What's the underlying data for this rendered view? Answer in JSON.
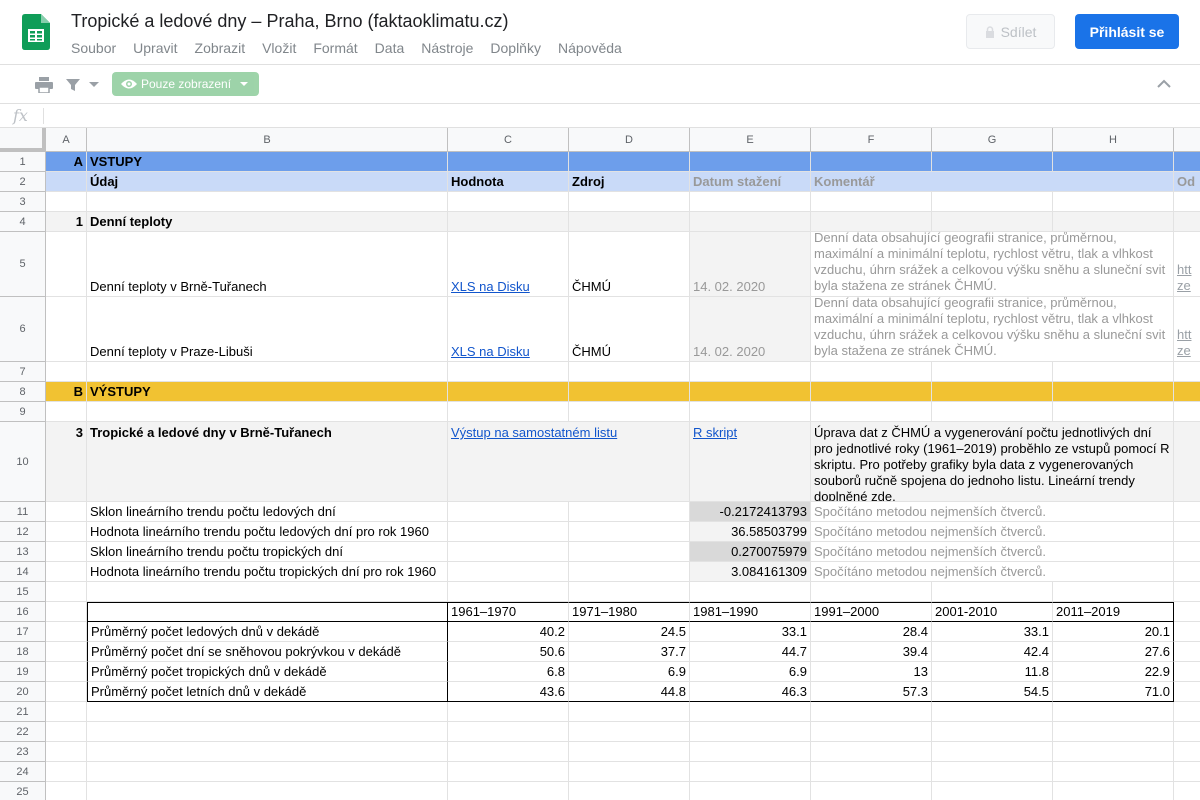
{
  "doc": {
    "title": "Tropické a ledové dny – Praha, Brno (faktaoklimatu.cz)",
    "menu": [
      "Soubor",
      "Upravit",
      "Zobrazit",
      "Vložit",
      "Formát",
      "Data",
      "Nástroje",
      "Doplňky",
      "Nápověda"
    ],
    "share_label": "Sdílet",
    "signin_label": "Přihlásit se"
  },
  "toolbar": {
    "view_only_label": "Pouze zobrazení",
    "fx_label": "fx",
    "formula_value": ""
  },
  "columns": [
    "A",
    "B",
    "C",
    "D",
    "E",
    "F",
    "G",
    "H"
  ],
  "rows": [
    "1",
    "2",
    "3",
    "4",
    "5",
    "6",
    "7",
    "8",
    "9",
    "10",
    "11",
    "12",
    "13",
    "14",
    "15",
    "16",
    "17",
    "18",
    "19",
    "20",
    "21",
    "22",
    "23",
    "24",
    "25"
  ],
  "cells": {
    "r1": {
      "a": "A",
      "b": "VSTUPY"
    },
    "r2": {
      "b": "Údaj",
      "c": "Hodnota",
      "d": "Zdroj",
      "e": "Datum stažení",
      "f": "Komentář",
      "i": "Od"
    },
    "r4": {
      "a": "1",
      "b": "Denní teploty"
    },
    "r5": {
      "b": "Denní teploty v Brně-Tuřanech",
      "c": "XLS na Disku",
      "d": "ČHMÚ",
      "e": "14. 02. 2020",
      "f": "Denní data obsahující geografii stranice, průměrnou, maximální a minimální teplotu, rychlost větru, tlak a vlhkost vzduchu, úhrn srážek a celkovou výšku sněhu a sluneční svit byla stažena ze stránek ČHMÚ.",
      "i": "htt ze"
    },
    "r6": {
      "b": "Denní teploty v Praze-Libuši",
      "c": "XLS na Disku",
      "d": "ČHMÚ",
      "e": "14. 02. 2020",
      "f": "Denní data obsahující geografii stranice, průměrnou, maximální a minimální teplotu, rychlost větru, tlak a vlhkost vzduchu, úhrn srážek a celkovou výšku sněhu a sluneční svit byla stažena ze stránek ČHMÚ.",
      "i": "htt ze"
    },
    "r8": {
      "a": "B",
      "b": "VÝSTUPY"
    },
    "r10": {
      "a": "3",
      "b": "Tropické a ledové dny v Brně-Tuřanech",
      "c": "Výstup na samostatném listu",
      "e": "R skript",
      "f": "Úprava dat z ČHMÚ a vygenerování počtu jednotlivých dní pro jednotlivé roky (1961–2019) proběhlo ze vstupů pomocí R skriptu. Pro potřeby grafiky byla data z vygenerovaných souborů ručně spojena do jednoho listu. Lineární trendy doplněné zde."
    },
    "r11": {
      "b": "Sklon lineárního trendu počtu ledových dní",
      "e": "-0.2172413793",
      "f": "Spočítáno metodou nejmenších čtverců."
    },
    "r12": {
      "b": "Hodnota lineárního trendu počtu ledových dní pro rok 1960",
      "e": "36.58503799",
      "f": "Spočítáno metodou nejmenších čtverců."
    },
    "r13": {
      "b": "Sklon lineárního trendu počtu tropických dní",
      "e": "0.270075979",
      "f": "Spočítáno metodou nejmenších čtverců."
    },
    "r14": {
      "b": "Hodnota lineárního trendu počtu tropických dní pro rok 1960",
      "e": "3.084161309",
      "f": "Spočítáno metodou nejmenších čtverců."
    }
  },
  "table": {
    "headers": [
      "1961–1970",
      "1971–1980",
      "1981–1990",
      "1991–2000",
      "2001-2010",
      "2011–2019"
    ],
    "rows": [
      {
        "label": "Průměrný počet ledových dnů v dekádě",
        "values": [
          "40.2",
          "24.5",
          "33.1",
          "28.4",
          "33.1",
          "20.1"
        ]
      },
      {
        "label": "Průměrný počet dní se sněhovou pokrývkou v dekádě",
        "values": [
          "50.6",
          "37.7",
          "44.7",
          "39.4",
          "42.4",
          "27.6"
        ]
      },
      {
        "label": "Průměrný počet tropických dnů v dekádě",
        "values": [
          "6.8",
          "6.9",
          "6.9",
          "13",
          "11.8",
          "22.9"
        ]
      },
      {
        "label": "Průměrný počet letních dnů v dekádě",
        "values": [
          "43.6",
          "44.8",
          "46.3",
          "57.3",
          "54.5",
          "71.0"
        ]
      }
    ]
  },
  "colors": {
    "accent": "#1a73e8",
    "section_input": "#6d9eeb",
    "section_header": "#c9daf8",
    "section_output": "#f1c232"
  }
}
